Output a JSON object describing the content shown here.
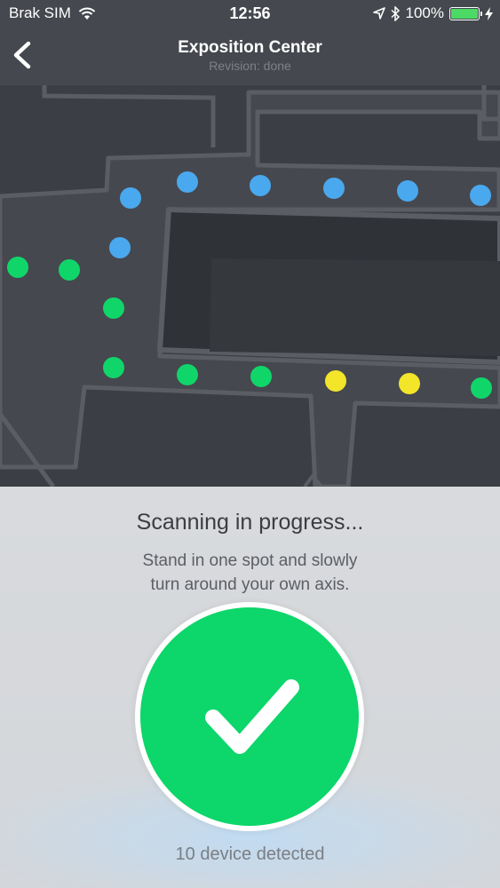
{
  "status_bar": {
    "carrier": "Brak SIM",
    "time": "12:56",
    "battery": "100%",
    "battery_level": 1.0,
    "icons": [
      "wifi-icon",
      "location-arrow-icon",
      "bluetooth-icon",
      "battery-icon",
      "charging-bolt-icon"
    ]
  },
  "nav": {
    "title": "Exposition Center",
    "subtitle": "Revision: done",
    "back_icon": "chevron-left-icon"
  },
  "map": {
    "colors": {
      "background": "#3b3e44",
      "corridor": "#45484e",
      "wall": "#5a5d63",
      "blue": "#4aa8ee",
      "green": "#10d66a",
      "yellow": "#f2e52a"
    },
    "markers": [
      {
        "color": "blue"
      },
      {
        "color": "blue"
      },
      {
        "color": "blue"
      },
      {
        "color": "blue"
      },
      {
        "color": "blue"
      },
      {
        "color": "blue"
      },
      {
        "color": "blue"
      },
      {
        "color": "green"
      },
      {
        "color": "green"
      },
      {
        "color": "green"
      },
      {
        "color": "green"
      },
      {
        "color": "green"
      },
      {
        "color": "green"
      },
      {
        "color": "green"
      },
      {
        "color": "yellow"
      },
      {
        "color": "yellow"
      }
    ]
  },
  "scan": {
    "heading": "Scanning in progress...",
    "instruction_line1": "Stand in one spot and slowly",
    "instruction_line2": "turn around your own axis.",
    "status_icon": "checkmark-icon",
    "status_color": "#0dd66a",
    "detected_text": "10 device detected"
  }
}
